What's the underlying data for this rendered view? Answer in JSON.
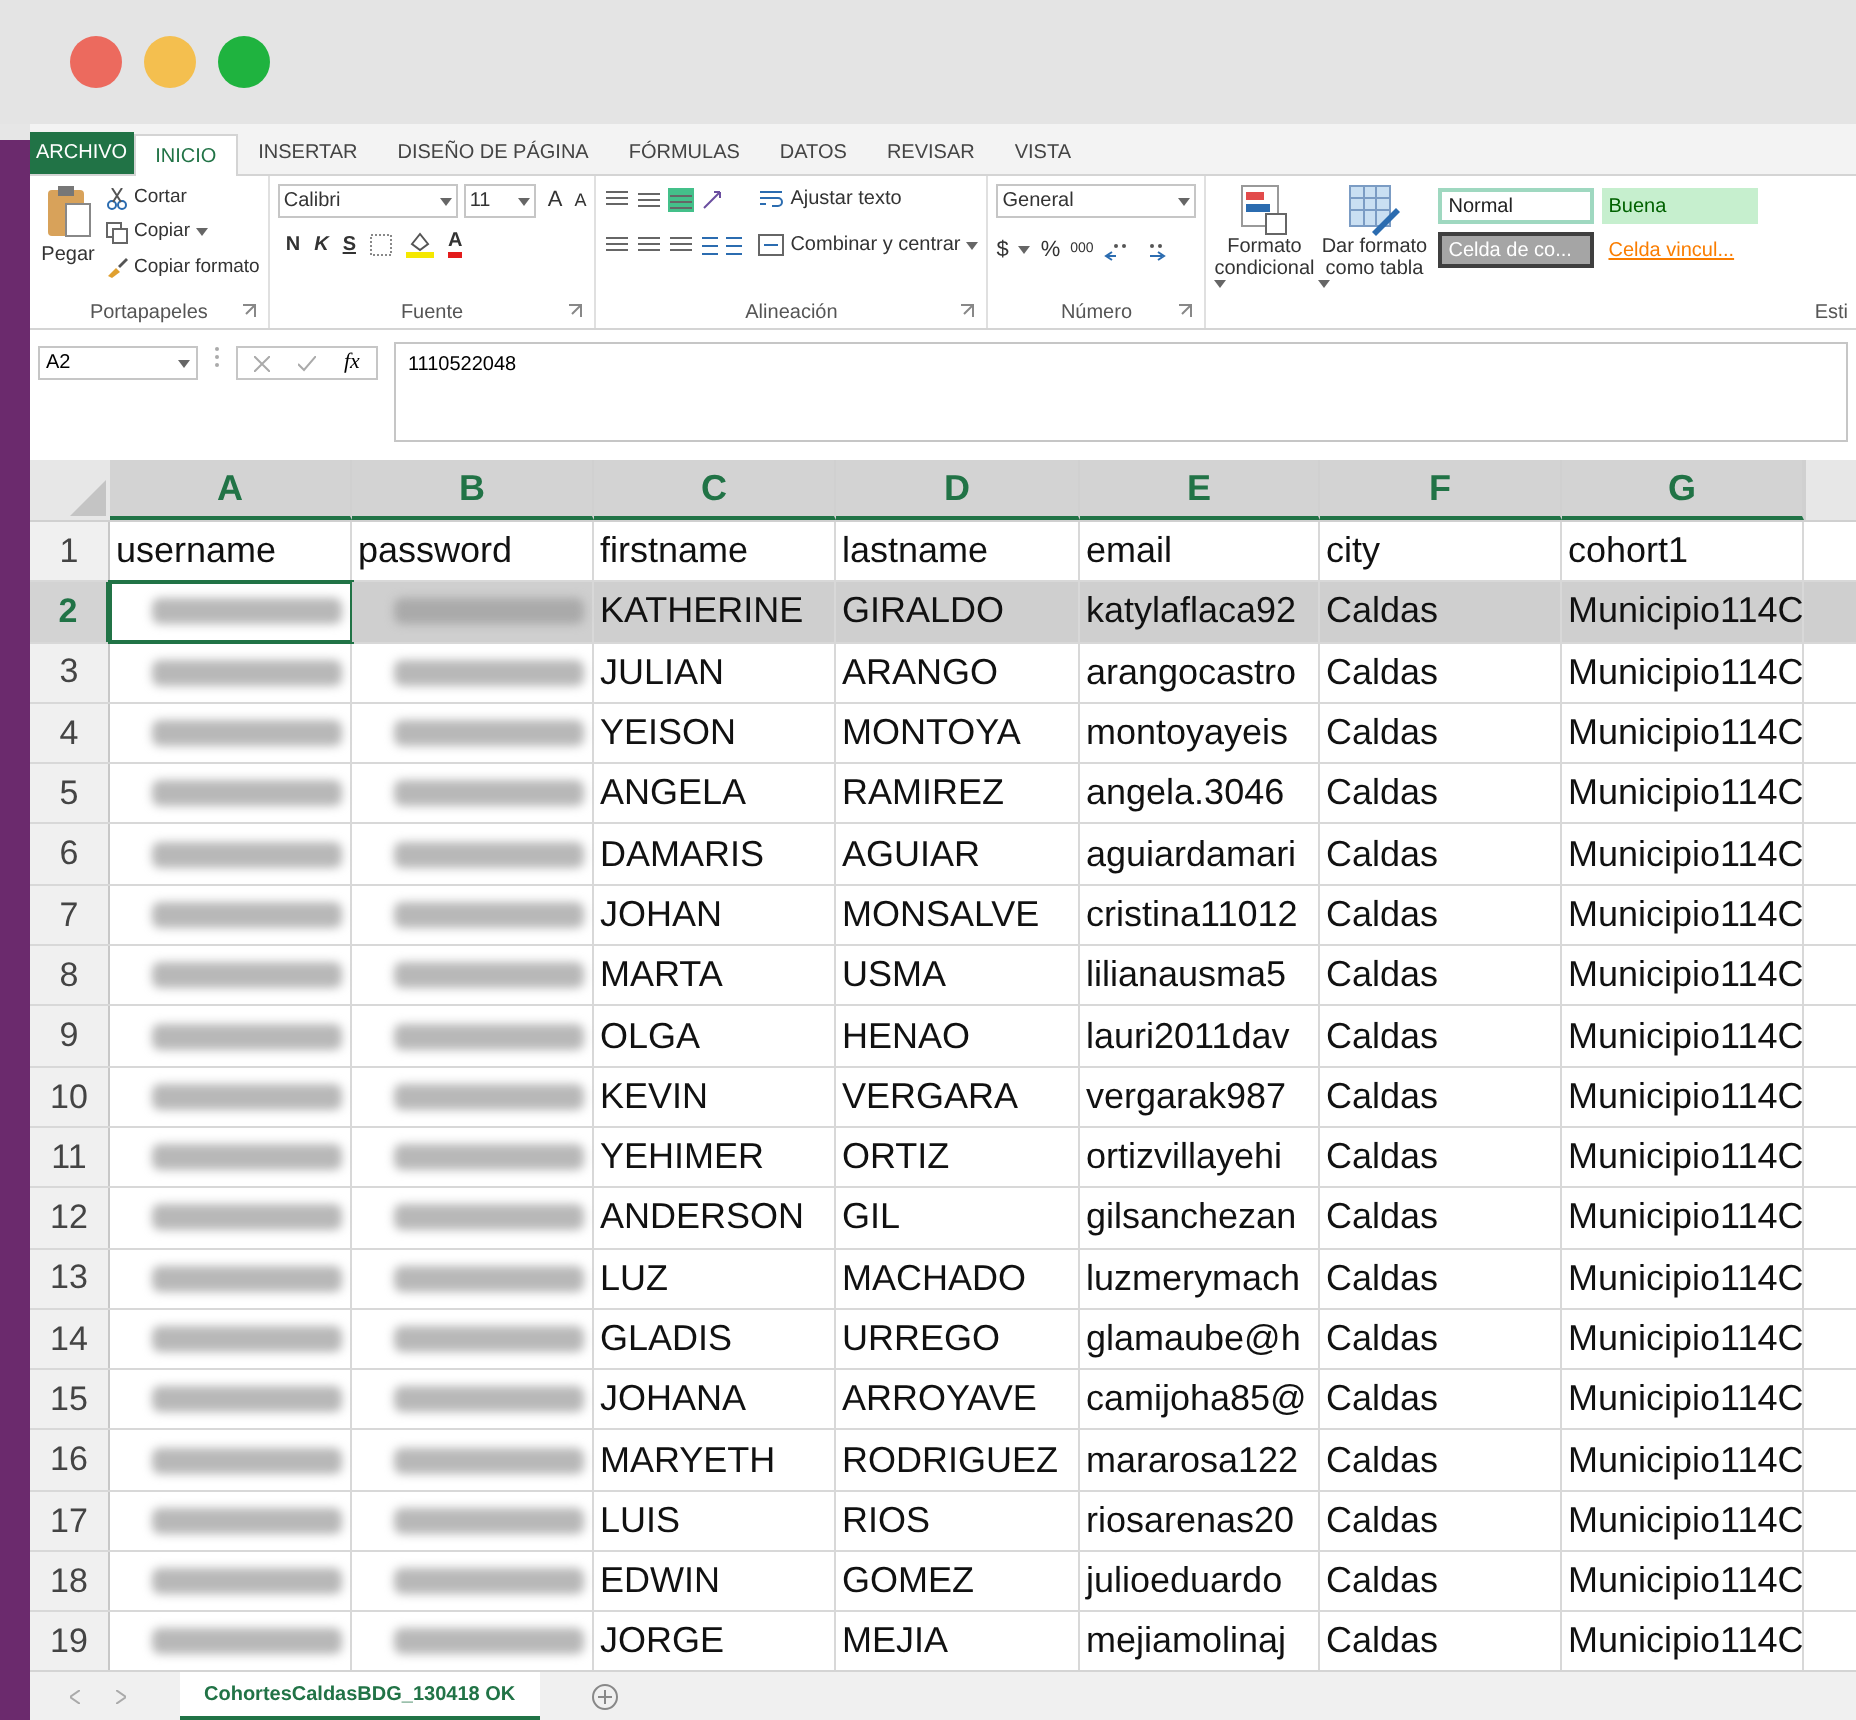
{
  "ribbon_tabs": [
    {
      "label": "ARCHIVO",
      "kind": "file"
    },
    {
      "label": "INICIO",
      "kind": "tab",
      "selected": true
    },
    {
      "label": "INSERTAR",
      "kind": "tab",
      "selected": false
    },
    {
      "label": "DISEÑO DE PÁGINA",
      "kind": "tab",
      "selected": false
    },
    {
      "label": "FÓRMULAS",
      "kind": "tab",
      "selected": false
    },
    {
      "label": "DATOS",
      "kind": "tab",
      "selected": false
    },
    {
      "label": "REVISAR",
      "kind": "tab",
      "selected": false
    },
    {
      "label": "VISTA",
      "kind": "tab",
      "selected": false
    }
  ],
  "ribbon": {
    "clipboard": {
      "paste": "Pegar",
      "cut": "Cortar",
      "copy": "Copiar",
      "format_painter": "Copiar formato",
      "group": "Portapapeles"
    },
    "font": {
      "name": "Calibri",
      "size": "11",
      "grow": "A",
      "shrink": "A",
      "bold": "N",
      "italic": "K",
      "underline": "S",
      "font_color": "A",
      "group": "Fuente"
    },
    "alignment": {
      "wrap": "Ajustar texto",
      "merge": "Combinar y centrar",
      "group": "Alineación"
    },
    "number": {
      "format": "General",
      "currency": "$",
      "percent": "%",
      "thousands": "000",
      "group": "Número"
    },
    "styles": {
      "conditional": "Formato condicional",
      "as_table": "Dar formato como tabla",
      "group": "Esti",
      "cells": [
        {
          "label": "Normal",
          "kind": "normal"
        },
        {
          "label": "Buena",
          "kind": "good"
        },
        {
          "label": "Celda de co...",
          "kind": "check"
        },
        {
          "label": "Celda vincul...",
          "kind": "linked"
        }
      ]
    }
  },
  "formula_bar": {
    "name_box": "A2",
    "function_label": "fx",
    "value": "1110522048"
  },
  "columns": [
    {
      "label": "A",
      "selected": true
    },
    {
      "label": "B",
      "selected": true
    },
    {
      "label": "C",
      "selected": true
    },
    {
      "label": "D",
      "selected": true
    },
    {
      "label": "E",
      "selected": true
    },
    {
      "label": "F",
      "selected": true
    },
    {
      "label": "G",
      "selected": true
    }
  ],
  "rows": [
    {
      "number": "1",
      "selected": false,
      "cells": [
        "username",
        "password",
        "firstname",
        "lastname",
        "email",
        "city",
        "cohort1"
      ]
    },
    {
      "number": "2",
      "selected": true,
      "cells": [
        {
          "kind": "blurred"
        },
        {
          "kind": "blurred"
        },
        "KATHERINE",
        "GIRALDO",
        "katylaflaca92",
        "Caldas",
        "Municipio114C"
      ]
    },
    {
      "number": "3",
      "selected": false,
      "cells": [
        {
          "kind": "blurred"
        },
        {
          "kind": "blurred"
        },
        "JULIAN",
        "ARANGO",
        "arangocastro",
        "Caldas",
        "Municipio114C"
      ]
    },
    {
      "number": "4",
      "selected": false,
      "cells": [
        {
          "kind": "blurred"
        },
        {
          "kind": "blurred"
        },
        "YEISON",
        "MONTOYA",
        "montoyayeis",
        "Caldas",
        "Municipio114C"
      ]
    },
    {
      "number": "5",
      "selected": false,
      "cells": [
        {
          "kind": "blurred"
        },
        {
          "kind": "blurred"
        },
        "ANGELA",
        "RAMIREZ",
        "angela.3046",
        "Caldas",
        "Municipio114C"
      ]
    },
    {
      "number": "6",
      "selected": false,
      "cells": [
        {
          "kind": "blurred"
        },
        {
          "kind": "blurred"
        },
        "DAMARIS",
        "AGUIAR",
        "aguiardamari",
        "Caldas",
        "Municipio114C"
      ]
    },
    {
      "number": "7",
      "selected": false,
      "cells": [
        {
          "kind": "blurred"
        },
        {
          "kind": "blurred"
        },
        "JOHAN",
        "MONSALVE",
        "cristina11012",
        "Caldas",
        "Municipio114C"
      ]
    },
    {
      "number": "8",
      "selected": false,
      "cells": [
        {
          "kind": "blurred"
        },
        {
          "kind": "blurred"
        },
        "MARTA",
        "USMA",
        "lilianausma5",
        "Caldas",
        "Municipio114C"
      ]
    },
    {
      "number": "9",
      "selected": false,
      "cells": [
        {
          "kind": "blurred"
        },
        {
          "kind": "blurred"
        },
        "OLGA",
        "HENAO",
        "lauri2011dav",
        "Caldas",
        "Municipio114C"
      ]
    },
    {
      "number": "10",
      "selected": false,
      "cells": [
        {
          "kind": "blurred"
        },
        {
          "kind": "blurred"
        },
        "KEVIN",
        "VERGARA",
        "vergarak987",
        "Caldas",
        "Municipio114C"
      ]
    },
    {
      "number": "11",
      "selected": false,
      "cells": [
        {
          "kind": "blurred"
        },
        {
          "kind": "blurred"
        },
        "YEHIMER",
        "ORTIZ",
        "ortizvillayehi",
        "Caldas",
        "Municipio114C"
      ]
    },
    {
      "number": "12",
      "selected": false,
      "cells": [
        {
          "kind": "blurred"
        },
        {
          "kind": "blurred"
        },
        "ANDERSON",
        "GIL",
        "gilsanchezan",
        "Caldas",
        "Municipio114C"
      ]
    },
    {
      "number": "13",
      "selected": false,
      "cells": [
        {
          "kind": "blurred"
        },
        {
          "kind": "blurred"
        },
        "LUZ",
        "MACHADO",
        "luzmerymach",
        "Caldas",
        "Municipio114C"
      ]
    },
    {
      "number": "14",
      "selected": false,
      "cells": [
        {
          "kind": "blurred"
        },
        {
          "kind": "blurred"
        },
        "GLADIS",
        "URREGO",
        "glamaube@h",
        "Caldas",
        "Municipio114C"
      ]
    },
    {
      "number": "15",
      "selected": false,
      "cells": [
        {
          "kind": "blurred"
        },
        {
          "kind": "blurred"
        },
        "JOHANA",
        "ARROYAVE",
        "camijoha85@",
        "Caldas",
        "Municipio114C"
      ]
    },
    {
      "number": "16",
      "selected": false,
      "cells": [
        {
          "kind": "blurred"
        },
        {
          "kind": "blurred"
        },
        "MARYETH",
        "RODRIGUEZ",
        "mararosa122",
        "Caldas",
        "Municipio114C"
      ]
    },
    {
      "number": "17",
      "selected": false,
      "cells": [
        {
          "kind": "blurred"
        },
        {
          "kind": "blurred"
        },
        "LUIS",
        "RIOS",
        "riosarenas20",
        "Caldas",
        "Municipio114C"
      ]
    },
    {
      "number": "18",
      "selected": false,
      "cells": [
        {
          "kind": "blurred"
        },
        {
          "kind": "blurred"
        },
        "EDWIN",
        "GOMEZ",
        "julioeduardo",
        "Caldas",
        "Municipio114C"
      ]
    },
    {
      "number": "19",
      "selected": false,
      "cells": [
        {
          "kind": "blurred"
        },
        {
          "kind": "blurred"
        },
        "JORGE",
        "MEJIA",
        "mejiamolinaj",
        "Caldas",
        "Municipio114C"
      ]
    }
  ],
  "sheet_tabs": [
    {
      "label": "CohortesCaldasBDG_130418 OK",
      "selected": true
    }
  ]
}
